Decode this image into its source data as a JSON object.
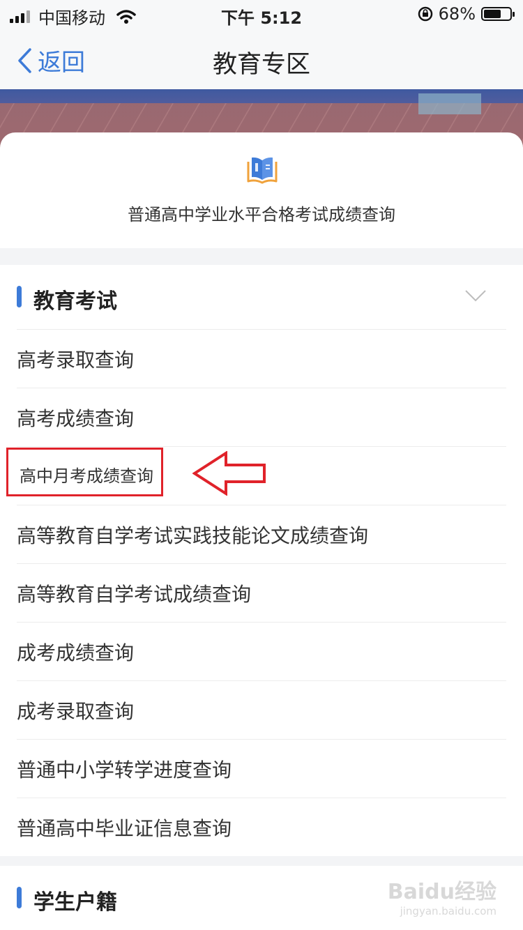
{
  "status_bar": {
    "carrier": "中国移动",
    "time": "下午 5:12",
    "battery": "68%",
    "battery_level": 0.68
  },
  "nav": {
    "back_label": "返回",
    "title": "教育专区"
  },
  "feature": {
    "label": "普通高中学业水平合格考试成绩查询"
  },
  "education_section": {
    "title": "教育考试",
    "items": [
      {
        "label": "高考录取查询"
      },
      {
        "label": "高考成绩查询"
      },
      {
        "label": "高中月考成绩查询"
      },
      {
        "label": "高等教育自学考试实践技能论文成绩查询"
      },
      {
        "label": "高等教育自学考试成绩查询"
      },
      {
        "label": "成考成绩查询"
      },
      {
        "label": "成考录取查询"
      },
      {
        "label": "普通中小学转学进度查询"
      },
      {
        "label": "普通高中毕业证信息查询"
      }
    ]
  },
  "student_section": {
    "title": "学生户籍"
  },
  "watermark": {
    "brand": "Baidu经验",
    "url": "jingyan.baidu.com"
  },
  "colors": {
    "accent": "#3d7bd8",
    "highlight": "#e0222a"
  }
}
